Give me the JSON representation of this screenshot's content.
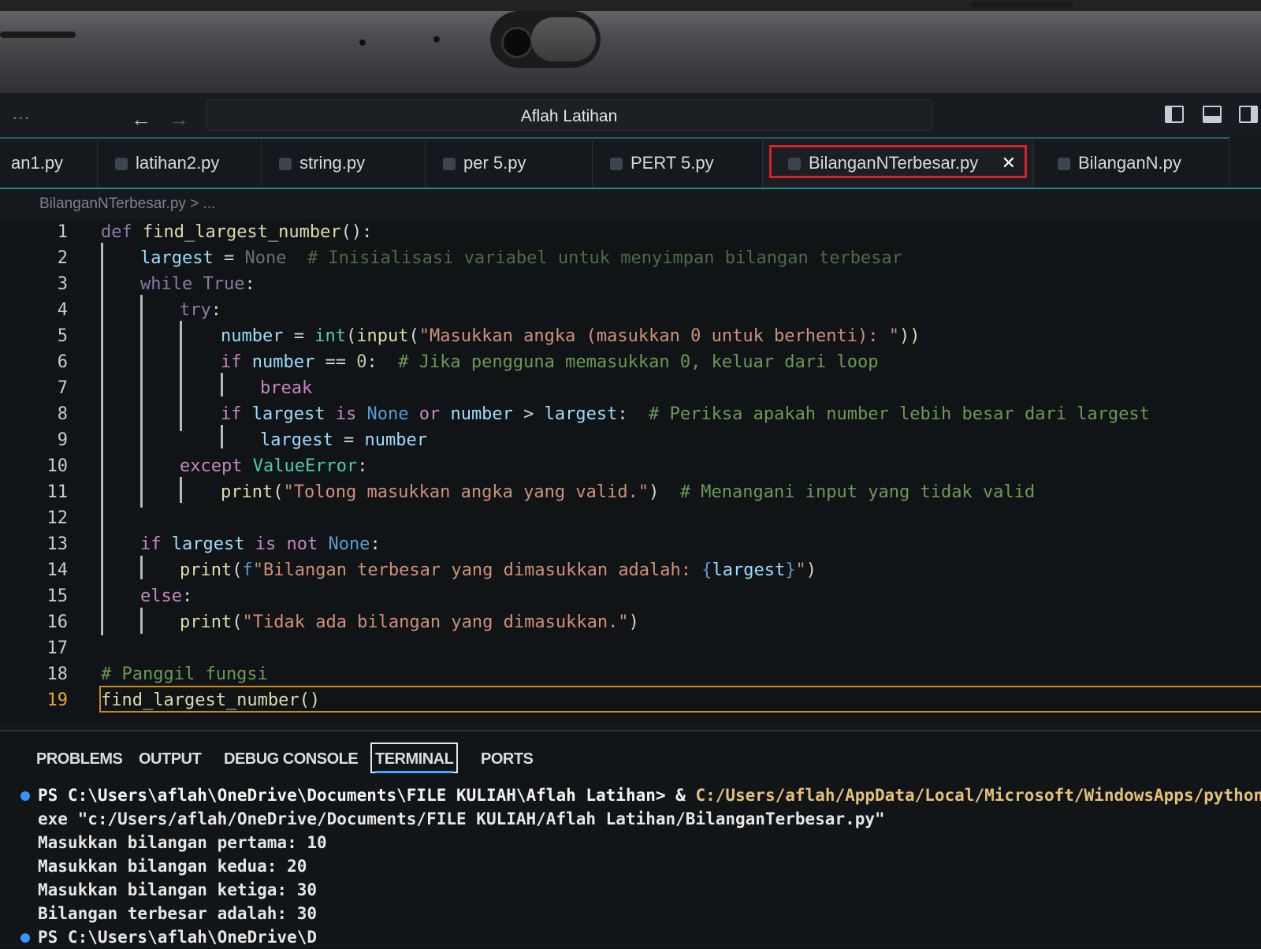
{
  "window": {
    "title": "Aflah Latihan",
    "menu": "...",
    "back": "←",
    "forward": "→"
  },
  "tabs": [
    {
      "label": "an1.py"
    },
    {
      "label": "latihan2.py"
    },
    {
      "label": "string.py"
    },
    {
      "label": "per 5.py"
    },
    {
      "label": "PERT 5.py"
    },
    {
      "label": "BilanganNTerbesar.py",
      "active": true,
      "close": "✕"
    },
    {
      "label": "BilanganN.py"
    }
  ],
  "breadcrumb": "BilanganNTerbesar.py > ...",
  "editor": {
    "current_line": 19,
    "line_numbers": [
      "1",
      "2",
      "3",
      "4",
      "5",
      "6",
      "7",
      "8",
      "9",
      "10",
      "11",
      "12",
      "13",
      "14",
      "15",
      "16",
      "17",
      "18",
      "19"
    ],
    "lines": {
      "l1": {
        "kw": "def ",
        "fn": "find_largest_number",
        "rest": "():"
      },
      "l2": {
        "var": "largest",
        "op": " = ",
        "kw": "None",
        "cm": "  # Inisialisasi variabel untuk menyimpan bilangan terbesar"
      },
      "l3": {
        "kw": "while",
        "sp": " ",
        "bi": "True",
        "op": ":"
      },
      "l4": {
        "kw": "try",
        "op": ":"
      },
      "l5": {
        "var": "number",
        "op": " = ",
        "cls": "int",
        "p1": "(",
        "fn": "input",
        "p2": "(",
        "str": "\"Masukkan angka (masukkan 0 untuk berhenti): \"",
        "p3": "))"
      },
      "l6": {
        "kw": "if",
        "sp": " ",
        "var": "number",
        "op": " == ",
        "num": "0",
        "colon": ":",
        "cm": "  # Jika pengguna memasukkan 0, keluar dari loop"
      },
      "l7": {
        "kw": "break"
      },
      "l8": {
        "kw": "if",
        "var1": " largest",
        "is": " is",
        "none": " None",
        "or": " or",
        "var2": " number",
        "gt": " > ",
        "var3": "largest",
        "colon": ":",
        "cm": "  # Periksa apakah number lebih besar dari largest"
      },
      "l9": {
        "var1": "largest",
        "op": " = ",
        "var2": "number"
      },
      "l10": {
        "kw": "except",
        "sp": " ",
        "cls": "ValueError",
        "op": ":"
      },
      "l11": {
        "fn": "print",
        "p1": "(",
        "str": "\"Tolong masukkan angka yang valid.\"",
        "p2": ")",
        "cm": "  # Menangani input yang tidak valid"
      },
      "l13": {
        "kw": "if",
        "var": " largest",
        "is": " is",
        "not": " not",
        "none": " None",
        "op": ":"
      },
      "l14": {
        "fn": "print",
        "p1": "(",
        "f": "f",
        "str1": "\"Bilangan terbesar yang dimasukkan adalah: ",
        "br1": "{",
        "var": "largest",
        "br2": "}",
        "str2": "\"",
        "p2": ")"
      },
      "l15": {
        "kw": "else",
        "op": ":"
      },
      "l16": {
        "fn": "print",
        "p1": "(",
        "str": "\"Tidak ada bilangan yang dimasukkan.\"",
        "p2": ")"
      },
      "l18": {
        "cm": "# Panggil fungsi"
      },
      "l19": {
        "fn": "find_largest_number",
        "p": "()"
      }
    }
  },
  "panel": {
    "tabs": [
      "PROBLEMS",
      "OUTPUT",
      "DEBUG CONSOLE",
      "TERMINAL",
      "PORTS"
    ],
    "active_tab": "TERMINAL",
    "terminal": {
      "prompt1": "PS C:\\Users\\aflah\\OneDrive\\Documents\\FILE KULIAH\\Aflah Latihan> & ",
      "cmd1": "C:/Users/aflah/AppData/Local/Microsoft/WindowsApps/python",
      "cmd2": "exe \"c:/Users/aflah/OneDrive/Documents/FILE KULIAH/Aflah Latihan/BilanganTerbesar.py\"",
      "out1": "Masukkan bilangan pertama: 10",
      "out2": "Masukkan bilangan kedua: 20",
      "out3": "Masukkan bilangan ketiga: 30",
      "out4": "Bilangan terbesar adalah: 30",
      "prompt2": "PS C:\\Users\\aflah\\OneDrive\\D"
    }
  },
  "colors": {
    "accent": "#238b8b",
    "active_tab_outline": "#d8202a",
    "current_line": "#c88a1e",
    "terminal_blue": "#3794ff"
  }
}
